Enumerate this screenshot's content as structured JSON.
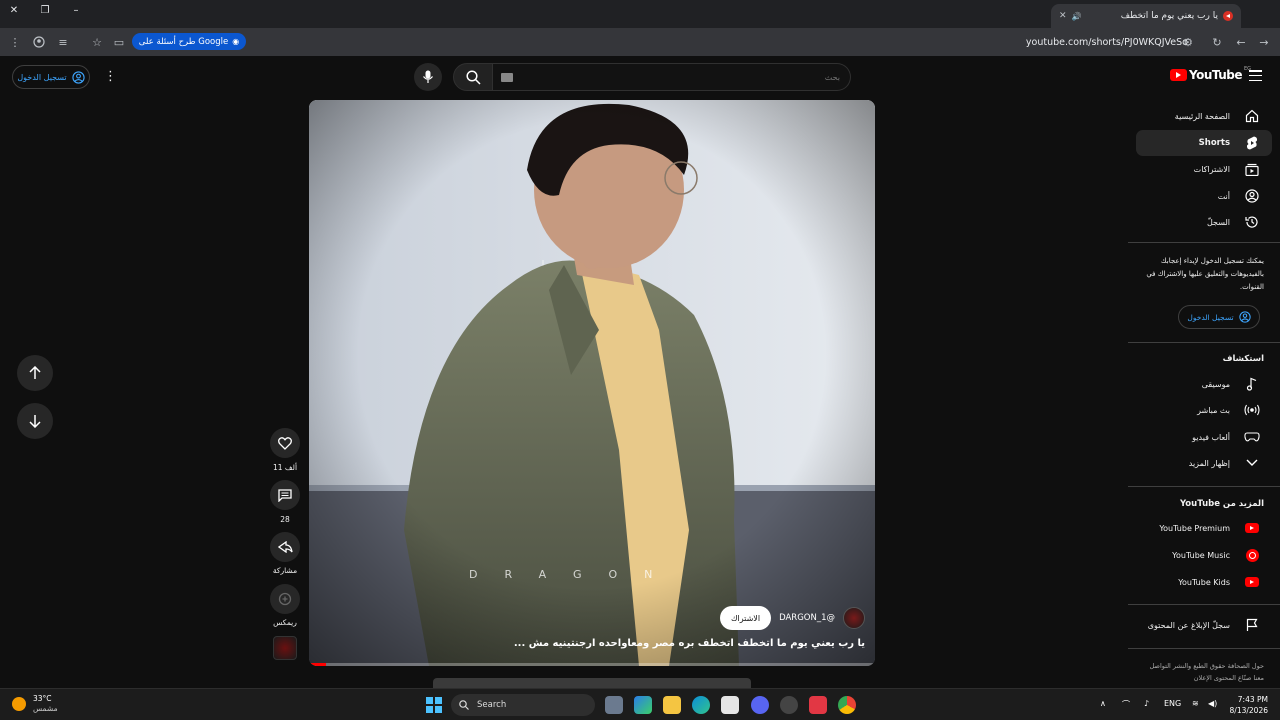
{
  "browser": {
    "tab_title": "يا رب يعني يوم ما اتخطف",
    "url": "youtube.com/shorts/PJ0WKQJVeSo",
    "google_pill": "طرح أسئلة على Google"
  },
  "masthead": {
    "signin_label": "تسجيل الدخول",
    "search_placeholder": "بحث",
    "logo_word": "YouTube",
    "country_code": "EG"
  },
  "short": {
    "progress_fraction": 0.03,
    "watermark": "DRAGON",
    "channel_name": "@DARGON_1",
    "subscribe_label": "الاشتراك",
    "caption": "يا رب يعني يوم ما اتخطف اتخطف بره مصر ومعاواحده ارجنتينيه مش ...",
    "likes": "11 ألف",
    "comments": "28",
    "share_label": "مشاركة",
    "remix_label": "ريمكس"
  },
  "sidebar": {
    "main": [
      {
        "label": "الصفحة الرئيسية",
        "icon": "home-icon"
      },
      {
        "label": "Shorts",
        "icon": "shorts-icon",
        "active": true
      },
      {
        "label": "الاشتراكات",
        "icon": "subscriptions-icon"
      },
      {
        "label": "أنت",
        "icon": "you-icon"
      },
      {
        "label": "السجلّ",
        "icon": "history-icon"
      }
    ],
    "promo_text": "يمكنك تسجيل الدخول لإبداء إعجابك بالفيديوهات والتعليق عليها والاشتراك في القنوات.",
    "promo_signin": "تسجيل الدخول",
    "explore_heading": "استكشاف",
    "explore": [
      {
        "label": "موسيقى",
        "icon": "music-icon"
      },
      {
        "label": "بث مباشر",
        "icon": "live-icon"
      },
      {
        "label": "ألعاب فيديو",
        "icon": "gaming-icon"
      },
      {
        "label": "إظهار المزيد",
        "icon": "chevron-down-icon"
      }
    ],
    "more_heading": "المزيد من YouTube",
    "more": [
      {
        "label": "YouTube Premium",
        "icon": "youtube-premium-icon"
      },
      {
        "label": "YouTube Music",
        "icon": "youtube-music-icon"
      },
      {
        "label": "YouTube Kids",
        "icon": "youtube-kids-icon"
      }
    ],
    "report_label": "سجلّ الإبلاغ عن المحتوى",
    "footer": "حول  الصحافة  حقوق الطبع والنشر  التواصل معنا  صنّاع المحتوى  الإعلان"
  },
  "taskbar": {
    "temperature": "33°C",
    "weather_desc": "مشمس",
    "search_label": "Search",
    "language": "ENG",
    "time": "7:43 PM",
    "date": "8/13/2026"
  }
}
